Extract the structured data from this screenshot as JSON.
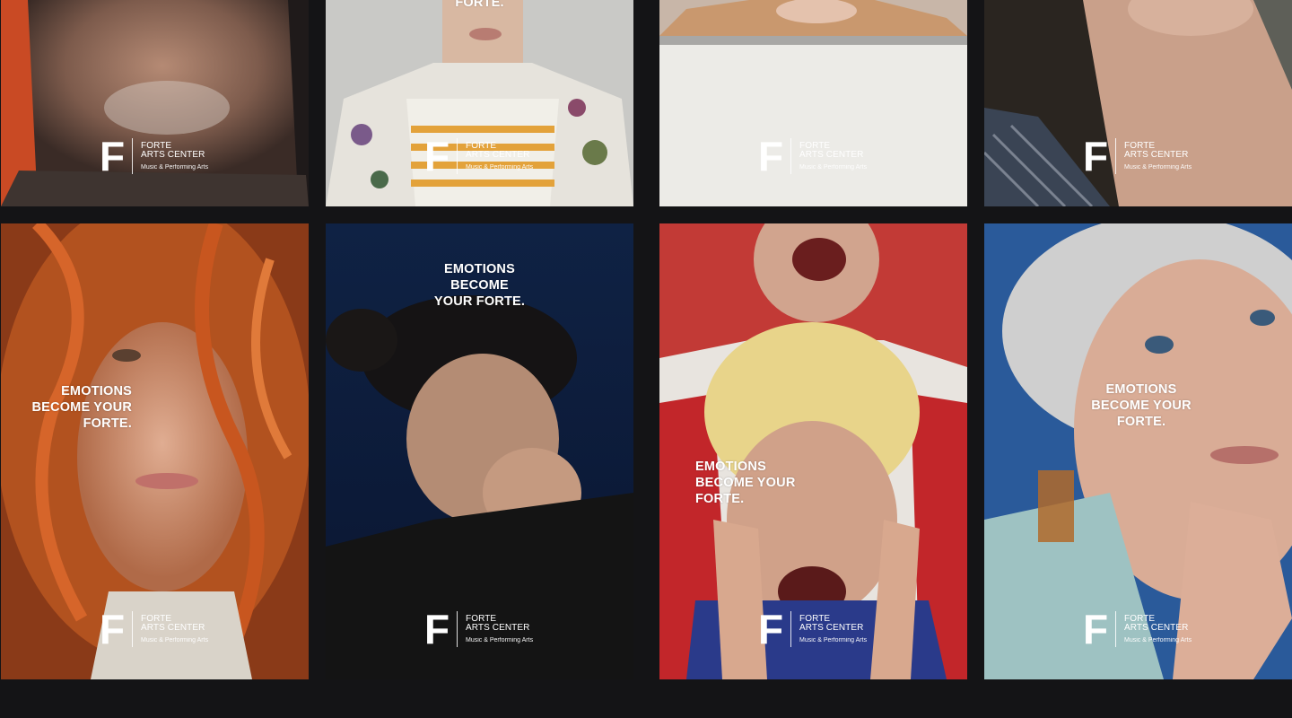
{
  "brand": {
    "mark": "F",
    "name_line1": "FORTE",
    "name_line2": "ARTS CENTER",
    "tagline": "Music & Performing Arts"
  },
  "posters": [
    {
      "id": "p1",
      "subject": "Older man face",
      "headline": ""
    },
    {
      "id": "p2",
      "subject": "Young man in floral shirt",
      "headline": "FORTE."
    },
    {
      "id": "p3",
      "subject": "Woman in white sweater",
      "headline": ""
    },
    {
      "id": "p4",
      "subject": "Woman neck and shoulder",
      "headline": ""
    },
    {
      "id": "p5",
      "subject": "Curly red-haired woman",
      "headline": "EMOTIONS\nBECOME YOUR\nFORTE."
    },
    {
      "id": "p6",
      "subject": "Woman with eyes closed holding nose",
      "headline": "EMOTIONS\nBECOME\nYOUR FORTE."
    },
    {
      "id": "p7",
      "subject": "Two people screaming",
      "headline": "EMOTIONS\nBECOME YOUR\nFORTE."
    },
    {
      "id": "p8",
      "subject": "Smiling older woman",
      "headline": "EMOTIONS\nBECOME YOUR\nFORTE."
    }
  ],
  "colors": {
    "background": "#141416",
    "text": "#ffffff"
  }
}
